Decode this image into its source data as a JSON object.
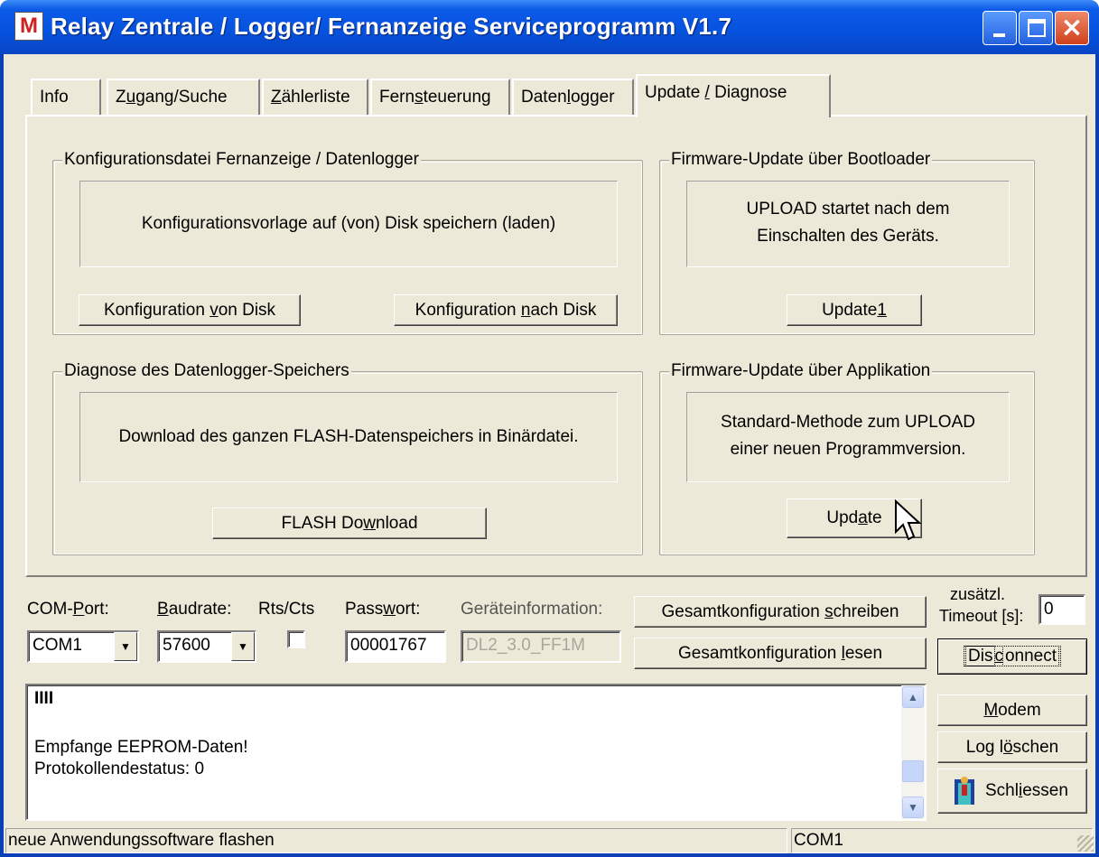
{
  "window": {
    "title": "Relay Zentrale / Logger/ Fernanzeige Serviceprogramm V1.7",
    "icon": "app-logo-icon"
  },
  "tabs": [
    {
      "label": "Info"
    },
    {
      "pre": "Z",
      "ul": "u",
      "post": "gang/Suche"
    },
    {
      "pre": "",
      "ul": "Z",
      "post": "ählerliste"
    },
    {
      "pre": "Fern",
      "ul": "s",
      "post": "teuerung"
    },
    {
      "pre": "Daten",
      "ul": "l",
      "post": "ogger"
    },
    {
      "pre": "Update ",
      "ul": "/",
      "post": " Diagnose"
    }
  ],
  "config_group": {
    "title": "Konfigurationsdatei Fernanzeige / Datenlogger",
    "text": "Konfigurationsvorlage auf (von) Disk speichern (laden)",
    "from_disk": {
      "pre": "Konfiguration ",
      "ul": "v",
      "post": "on Disk"
    },
    "to_disk": {
      "pre": "Konfiguration ",
      "ul": "n",
      "post": "ach Disk"
    }
  },
  "bootloader_group": {
    "title": "Firmware-Update über Bootloader",
    "text1": "UPLOAD startet nach dem",
    "text2": "Einschalten des Geräts.",
    "button": {
      "pre": "Update",
      "ul": "1",
      "post": ""
    }
  },
  "diag_group": {
    "title": "Diagnose des Datenlogger-Speichers",
    "text": "Download des ganzen FLASH-Datenspeichers in Binärdatei.",
    "button": {
      "pre": "FLASH Do",
      "ul": "w",
      "post": "nload"
    }
  },
  "app_group": {
    "title": "Firmware-Update über Applikation",
    "text1": "Standard-Methode zum UPLOAD",
    "text2": "einer neuen Programmversion.",
    "button": {
      "pre": "Upd",
      "ul": "a",
      "post": "te"
    }
  },
  "settings": {
    "com_port_label": {
      "pre": "COM-",
      "ul": "P",
      "post": "ort:"
    },
    "com_port_value": "COM1",
    "baudrate_label": {
      "pre": "",
      "ul": "B",
      "post": "audrate:"
    },
    "baudrate_value": "57600",
    "rtscts_label": "Rts/Cts",
    "rtscts_checked": false,
    "password_label": {
      "pre": "Pass",
      "ul": "w",
      "post": "ort:"
    },
    "password_value": "00001767",
    "devinfo_label": "Geräteinformation:",
    "devinfo_value": "DL2_3.0_FF1M",
    "write_all": {
      "pre": "Gesamtkonfiguration ",
      "ul": "s",
      "post": "chreiben"
    },
    "read_all": {
      "pre": "Gesamtkonfiguration ",
      "ul": "l",
      "post": "esen"
    },
    "timeout_label1": "zusätzl.",
    "timeout_label2": "Timeout [s]:",
    "timeout_value": "0"
  },
  "side_buttons": {
    "disconnect": {
      "pre": "Dis",
      "ul": "c",
      "post": "onnect"
    },
    "modem": {
      "pre": "",
      "ul": "M",
      "post": "odem"
    },
    "clear_log": {
      "pre": "Log l",
      "ul": "ö",
      "post": "schen"
    },
    "close": {
      "pre": "Schl",
      "ul": "i",
      "post": "essen"
    }
  },
  "log": {
    "line1": "IIII",
    "line2": "Empfange EEPROM-Daten!",
    "line3": "Protokollendestatus: 0"
  },
  "status": {
    "left": "neue Anwendungssoftware flashen",
    "right": "COM1"
  },
  "colors": {
    "title_blue": "#0552dd",
    "face": "#ece9d8"
  }
}
